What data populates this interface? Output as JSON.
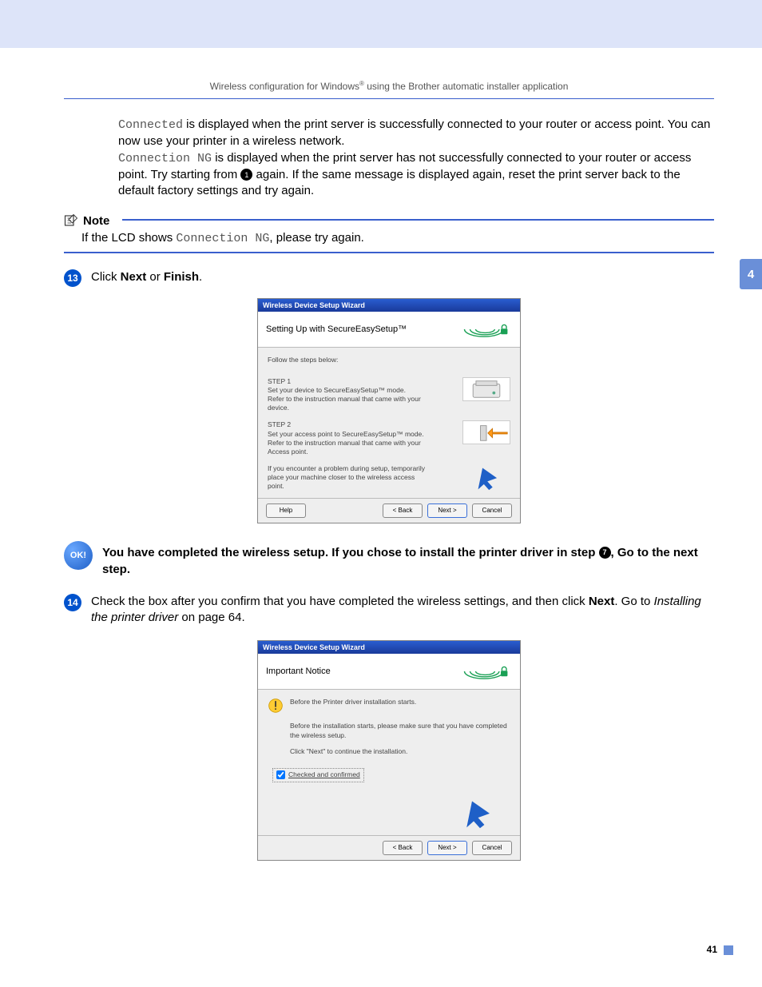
{
  "header": {
    "running_head_pre": "Wireless configuration for Windows",
    "reg": "®",
    "running_head_post": " using the Brother automatic installer application"
  },
  "chapter_tab": "4",
  "page_number": "41",
  "para1": {
    "mono": "Connected",
    "text": " is displayed when the print server is successfully connected to your router or access point. You can now use your printer in a wireless network."
  },
  "para2": {
    "mono": "Connection NG",
    "text_a": " is displayed when the print server has not successfully connected to your router or access point. Try starting from ",
    "ref": "1",
    "text_b": " again. If the same message is displayed again, reset the print server back to the default factory settings and try again."
  },
  "note": {
    "label": "Note",
    "text_a": "If the LCD shows ",
    "mono": "Connection NG",
    "text_b": ", please try again."
  },
  "step13": {
    "num": "13",
    "pre": "Click ",
    "b1": "Next",
    "mid": " or ",
    "b2": "Finish",
    "post": "."
  },
  "wizard1": {
    "title": "Wireless Device Setup Wizard",
    "heading": "Setting Up with SecureEasySetup™",
    "follow": "Follow the steps below:",
    "step1_h": "STEP 1",
    "step1_a": "Set your device to SecureEasySetup™ mode.",
    "step1_b": "Refer to the instruction manual that came with your device.",
    "step2_h": "STEP 2",
    "step2_a": "Set your access point to SecureEasySetup™ mode.",
    "step2_b": "Refer to the instruction manual that came with your Access point.",
    "trouble": "If you encounter a problem during setup, temporarily place your machine closer to the wireless access point.",
    "help": "Help",
    "back": "< Back",
    "next": "Next >",
    "cancel": "Cancel"
  },
  "ok_block": {
    "badge": "OK!",
    "text_a": "You have completed the wireless setup. If you chose to install the printer driver in step ",
    "ref": "7",
    "text_b": ", Go to the next step."
  },
  "step14": {
    "num": "14",
    "text_a": "Check the box after you confirm that you have completed the wireless settings, and then click ",
    "b1": "Next",
    "text_b": ". Go to ",
    "italic": "Installing the printer driver",
    "text_c": " on page 64."
  },
  "wizard2": {
    "title": "Wireless Device Setup Wizard",
    "heading": "Important Notice",
    "line1": "Before the Printer driver installation starts.",
    "line2": "Before the installation starts, please make sure that you have completed the wireless setup.",
    "line3": "Click \"Next\" to continue the installation.",
    "checkbox": "Checked and confirmed",
    "back": "< Back",
    "next": "Next >",
    "cancel": "Cancel"
  }
}
